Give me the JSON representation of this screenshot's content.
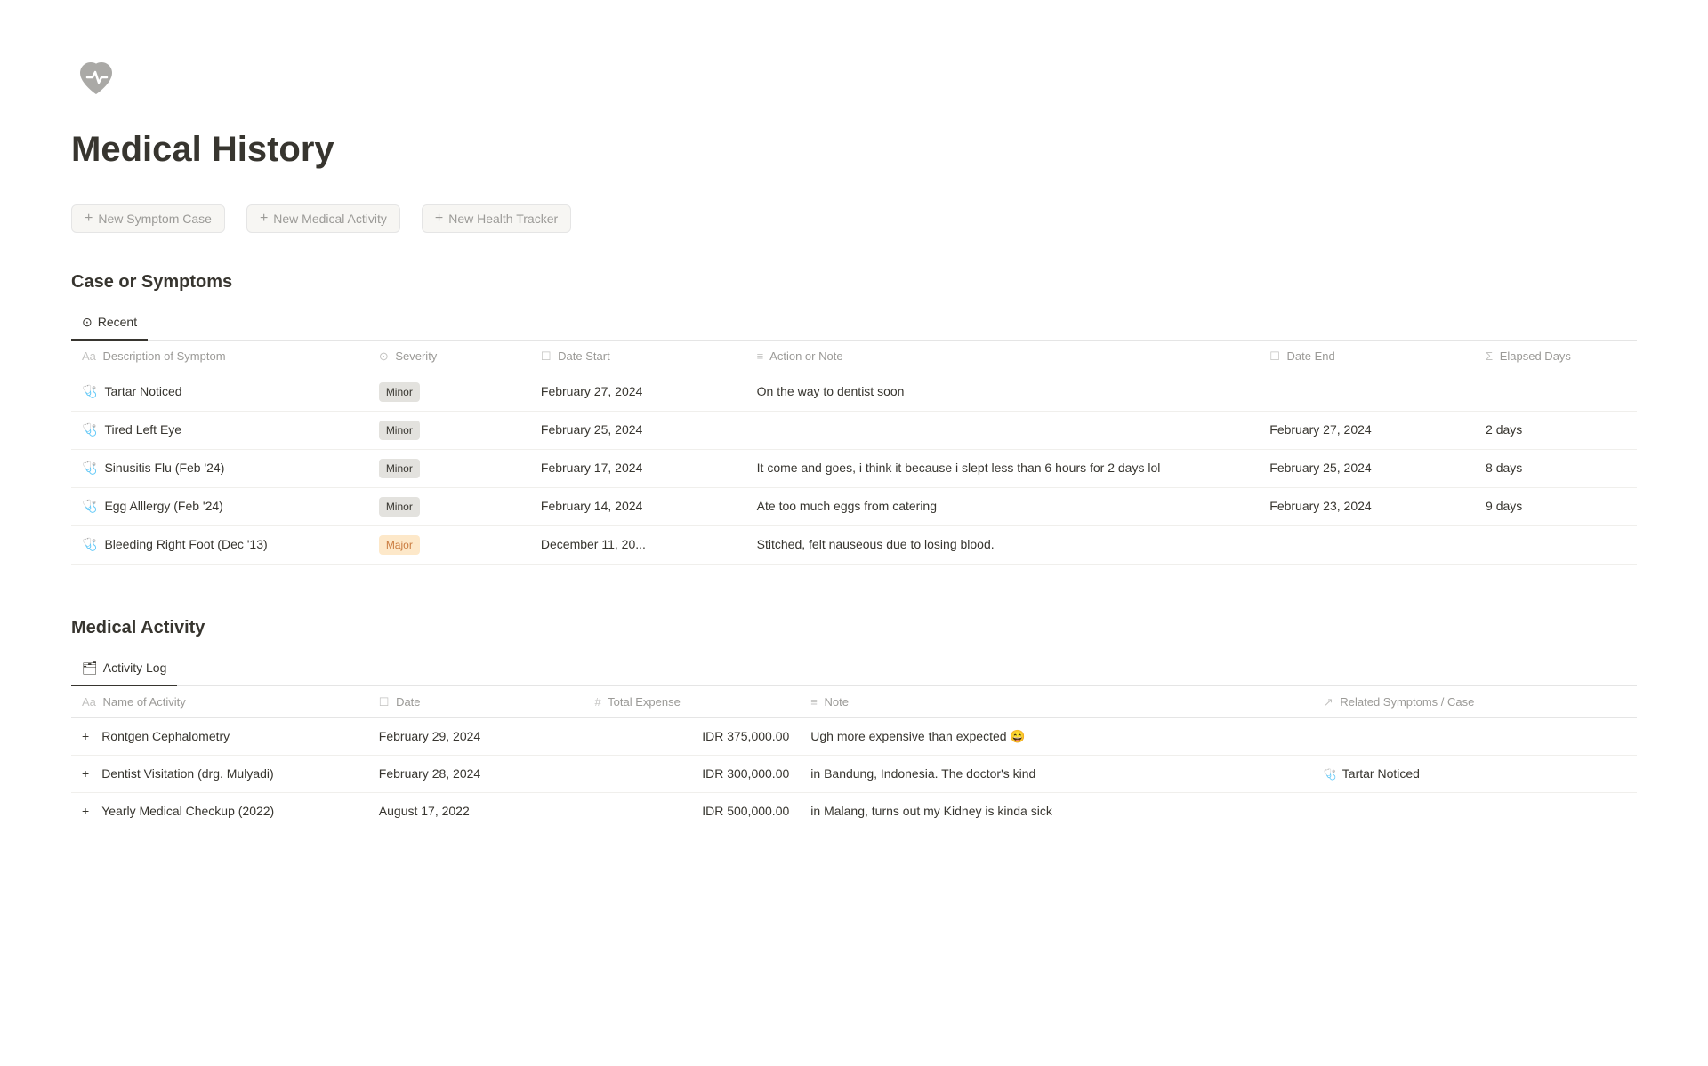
{
  "logo": {
    "alt": "health-tracker-logo"
  },
  "pageTitle": "Medical History",
  "actions": [
    {
      "id": "new-symptom-case",
      "label": "New Symptom Case"
    },
    {
      "id": "new-medical-activity",
      "label": "New Medical Activity"
    },
    {
      "id": "new-health-tracker",
      "label": "New Health Tracker"
    }
  ],
  "symptomsSection": {
    "title": "Case or Symptoms",
    "tab": "Recent",
    "columns": [
      {
        "icon": "Aa",
        "label": "Description of Symptom"
      },
      {
        "icon": "⊙",
        "label": "Severity"
      },
      {
        "icon": "☐",
        "label": "Date Start"
      },
      {
        "icon": "≡",
        "label": "Action or Note"
      },
      {
        "icon": "☐",
        "label": "Date End"
      },
      {
        "icon": "Σ",
        "label": "Elapsed Days"
      }
    ],
    "rows": [
      {
        "icon": "🩺",
        "description": "Tartar Noticed",
        "severity": "Minor",
        "severityType": "minor",
        "dateStart": "February 27, 2024",
        "actionNote": "On the way to dentist soon",
        "dateEnd": "",
        "elapsedDays": ""
      },
      {
        "icon": "🩺",
        "description": "Tired Left Eye",
        "severity": "Minor",
        "severityType": "minor",
        "dateStart": "February 25, 2024",
        "actionNote": "",
        "dateEnd": "February 27, 2024",
        "elapsedDays": "2 days"
      },
      {
        "icon": "🩺",
        "description": "Sinusitis Flu (Feb '24)",
        "severity": "Minor",
        "severityType": "minor",
        "dateStart": "February 17, 2024",
        "actionNote": "It come and goes, i think it because i slept less than 6 hours for 2 days lol",
        "dateEnd": "February 25, 2024",
        "elapsedDays": "8 days"
      },
      {
        "icon": "🩺",
        "description": "Egg Alllergy (Feb '24)",
        "severity": "Minor",
        "severityType": "minor",
        "dateStart": "February 14, 2024",
        "actionNote": "Ate too much eggs from catering",
        "dateEnd": "February 23, 2024",
        "elapsedDays": "9 days"
      },
      {
        "icon": "🩺",
        "description": "Bleeding Right Foot (Dec '13)",
        "severity": "Major",
        "severityType": "major",
        "dateStart": "December 11, 20...",
        "actionNote": "Stitched, felt nauseous due to losing blood.",
        "dateEnd": "",
        "elapsedDays": ""
      }
    ]
  },
  "activitySection": {
    "title": "Medical Activity",
    "tab": "Activity Log",
    "columns": [
      {
        "icon": "Aa",
        "label": "Name of Activity"
      },
      {
        "icon": "☐",
        "label": "Date"
      },
      {
        "icon": "#",
        "label": "Total Expense"
      },
      {
        "icon": "≡",
        "label": "Note"
      },
      {
        "icon": "↗",
        "label": "Related Symptoms / Case"
      }
    ],
    "rows": [
      {
        "icon": "+",
        "name": "Rontgen Cephalometry",
        "date": "February 29, 2024",
        "expense": "IDR 375,000.00",
        "note": "Ugh more expensive than expected 😄",
        "related": "",
        "relatedIcon": ""
      },
      {
        "icon": "+",
        "name": "Dentist Visitation (drg. Mulyadi)",
        "date": "February 28, 2024",
        "expense": "IDR 300,000.00",
        "note": "in Bandung, Indonesia. The doctor's kind",
        "related": "Tartar Noticed",
        "relatedIcon": "🩺"
      },
      {
        "icon": "+",
        "name": "Yearly Medical Checkup (2022)",
        "date": "August 17, 2022",
        "expense": "IDR 500,000.00",
        "note": "in Malang, turns out my Kidney is kinda sick",
        "related": "",
        "relatedIcon": ""
      }
    ]
  }
}
